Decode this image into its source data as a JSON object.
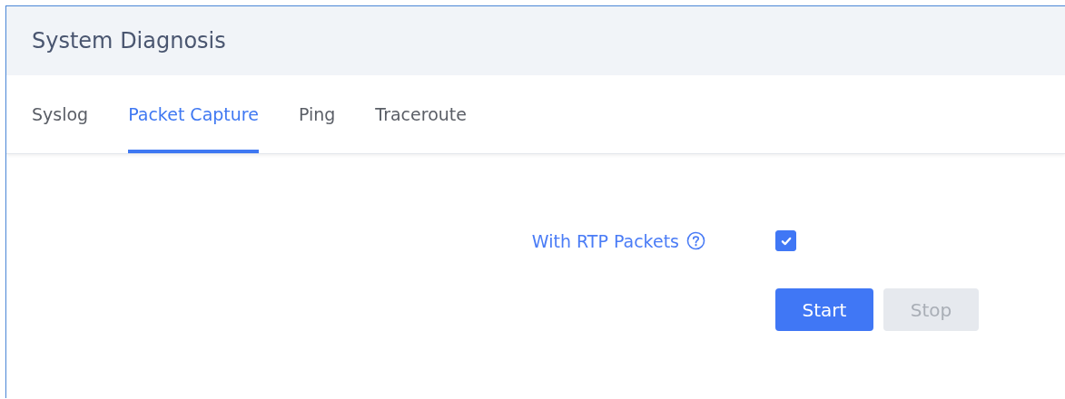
{
  "header": {
    "title": "System Diagnosis"
  },
  "tabs": [
    {
      "label": "Syslog",
      "selected": false
    },
    {
      "label": "Packet Capture",
      "selected": true
    },
    {
      "label": "Ping",
      "selected": false
    },
    {
      "label": "Traceroute",
      "selected": false
    }
  ],
  "option": {
    "label": "With RTP Packets",
    "checked": true
  },
  "buttons": [
    {
      "label": "Start",
      "disabled": false
    },
    {
      "label": "Stop",
      "disabled": true
    }
  ]
}
